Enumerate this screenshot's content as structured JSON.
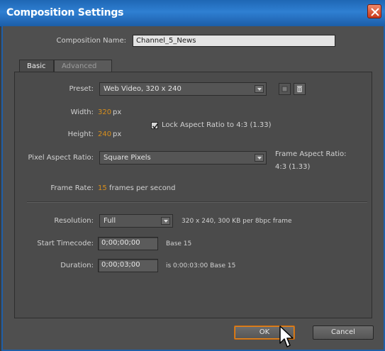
{
  "window": {
    "title": "Composition Settings"
  },
  "comp_name": {
    "label": "Composition Name:",
    "value": "Channel_5_News"
  },
  "tabs": [
    {
      "label": "Basic"
    },
    {
      "label": "Advanced"
    }
  ],
  "preset": {
    "label": "Preset:",
    "value": "Web Video, 320 x 240"
  },
  "width": {
    "label": "Width:",
    "value": "320",
    "unit": "px"
  },
  "height": {
    "label": "Height:",
    "value": "240",
    "unit": "px"
  },
  "lock_aspect": {
    "label": "Lock Aspect Ratio to 4:3 (1.33)",
    "checked": true
  },
  "pixel_aspect": {
    "label": "Pixel Aspect Ratio:",
    "value": "Square Pixels"
  },
  "frame_aspect": {
    "label": "Frame Aspect Ratio:",
    "value": "4:3 (1.33)"
  },
  "frame_rate": {
    "label": "Frame Rate:",
    "value": "15",
    "unit": "frames per second"
  },
  "resolution": {
    "label": "Resolution:",
    "value": "Full",
    "info": "320 x 240, 300 KB per 8bpc frame"
  },
  "start_timecode": {
    "label": "Start Timecode:",
    "value": "0;00;00;00",
    "info": "Base 15"
  },
  "duration": {
    "label": "Duration:",
    "value": "0;00;03;00",
    "info": "is 0:00:03:00  Base 15"
  },
  "buttons": {
    "ok": "OK",
    "cancel": "Cancel"
  },
  "colors": {
    "title_bar": "#2f7fd2",
    "accent_value": "#d88f1c",
    "ok_highlight": "#e6861b"
  }
}
